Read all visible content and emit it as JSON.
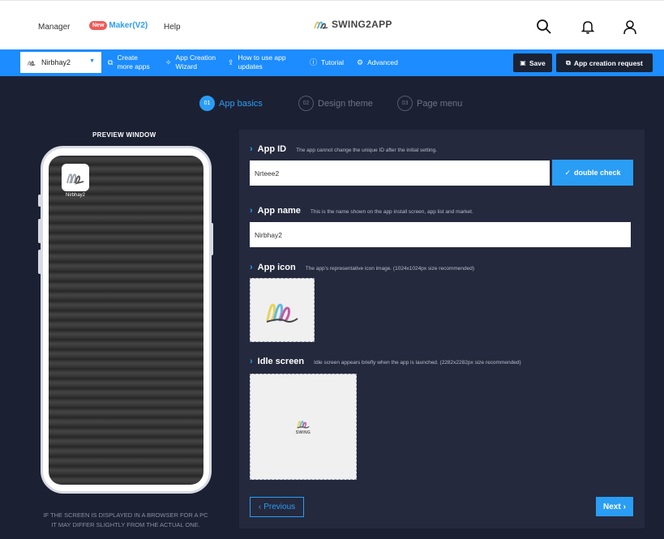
{
  "header": {
    "nav": {
      "manager": "Manager",
      "new_badge": "New",
      "maker": "Maker(V2)",
      "help": "Help"
    },
    "logo_text": "SWING2APP",
    "icons": [
      "search-icon",
      "bell-icon",
      "user-icon"
    ]
  },
  "toolbar": {
    "app_select": "Nirbhay2",
    "create_more_apps": "Create more apps",
    "app_creation_wizard": "App Creation Wizard",
    "how_to_use_app_updates": "How to use app updates",
    "tutorial": "Tutorial",
    "advanced": "Advanced",
    "save": "Save",
    "app_creation_request": "App creation request"
  },
  "steps": [
    {
      "num": "01",
      "label": "App basics",
      "active": true
    },
    {
      "num": "02",
      "label": "Design theme",
      "active": false
    },
    {
      "num": "03",
      "label": "Page menu",
      "active": false
    }
  ],
  "preview": {
    "title": "PREVIEW WINDOW",
    "app_label": "Nirbhay2",
    "note_line1": "IF THE SCREEN IS DISPLAYED IN A BROWSER FOR A PC",
    "note_line2": "IT MAY DIFFER SLIGHTLY FROM THE ACTUAL ONE."
  },
  "form": {
    "app_id": {
      "title": "App ID",
      "desc": "The app cannot change the unique ID after the initial setting.",
      "value": "Nrteee2",
      "check_button": "double check"
    },
    "app_name": {
      "title": "App name",
      "desc": "This is the name shown on the app install screen, app list and market.",
      "value": "Nirbhay2"
    },
    "app_icon": {
      "title": "App icon",
      "desc": "The app's representative icon image. (1024x1024px size recommended)"
    },
    "idle_screen": {
      "title": "Idle screen",
      "desc": "Idle screen appears briefly when the app is launched. (2282x2282px size recommended)",
      "logo_text": "SWING"
    }
  },
  "footer": {
    "previous": "Previous",
    "next": "Next"
  },
  "colors": {
    "accent": "#2a9df4",
    "toolbar": "#1c8cff",
    "background": "#1c2033",
    "panel": "#24293d",
    "badge": "#ef5a5a"
  }
}
